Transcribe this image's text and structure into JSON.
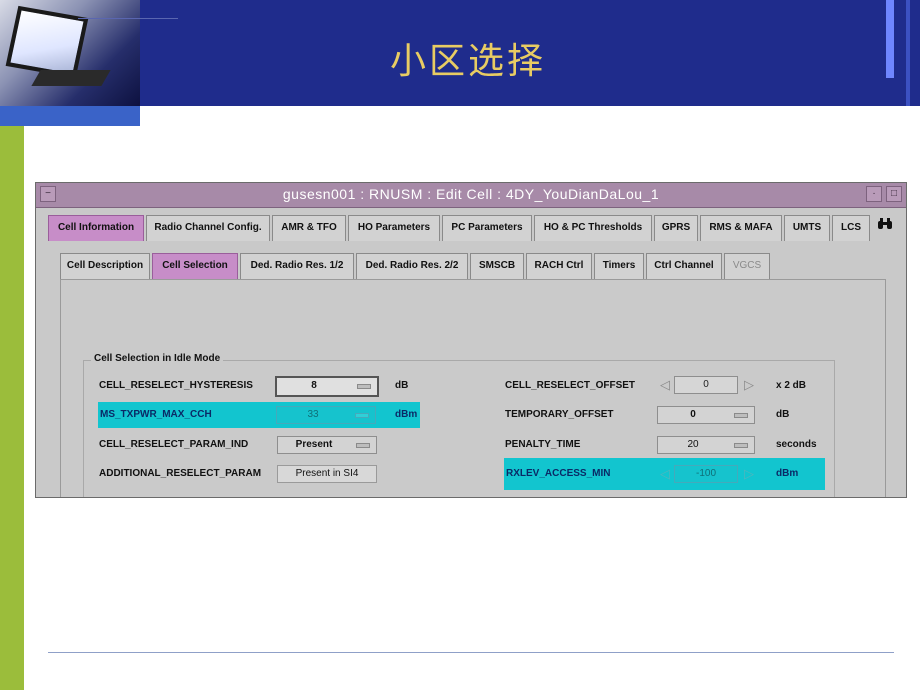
{
  "slide": {
    "title": "小区选择"
  },
  "window": {
    "title": "gusesn001 : RNUSM : Edit Cell : 4DY_YouDianDaLou_1",
    "menu_btn": "−",
    "min_btn": "·",
    "max_btn": "□"
  },
  "main_tabs": [
    {
      "label": "Cell Information",
      "active": true
    },
    {
      "label": "Radio Channel Config."
    },
    {
      "label": "AMR & TFO"
    },
    {
      "label": "HO Parameters"
    },
    {
      "label": "PC Parameters"
    },
    {
      "label": "HO & PC Thresholds"
    },
    {
      "label": "GPRS"
    },
    {
      "label": "RMS & MAFA"
    },
    {
      "label": "UMTS"
    },
    {
      "label": "LCS"
    }
  ],
  "binoculars_icon": "binoculars-icon",
  "sub_tabs": [
    {
      "label": "Cell Description"
    },
    {
      "label": "Cell Selection",
      "active": true
    },
    {
      "label": "Ded. Radio Res. 1/2"
    },
    {
      "label": "Ded. Radio Res. 2/2"
    },
    {
      "label": "SMSCB"
    },
    {
      "label": "RACH Ctrl"
    },
    {
      "label": "Timers"
    },
    {
      "label": "Ctrl Channel"
    },
    {
      "label": "VGCS",
      "disabled": true
    }
  ],
  "group": {
    "title": "Cell Selection in Idle Mode",
    "left": [
      {
        "label": "CELL_RESELECT_HYSTERESIS",
        "value": "8",
        "unit": "dB"
      },
      {
        "label": "MS_TXPWR_MAX_CCH",
        "value": "33",
        "unit": "dBm",
        "highlighted": true
      },
      {
        "label": "CELL_RESELECT_PARAM_IND",
        "value": "Present",
        "unit": ""
      },
      {
        "label": "ADDITIONAL_RESELECT_PARAM",
        "value": "Present in SI4",
        "unit": ""
      }
    ],
    "right": [
      {
        "label": "CELL_RESELECT_OFFSET",
        "value": "0",
        "unit": "x 2 dB"
      },
      {
        "label": "TEMPORARY_OFFSET",
        "value": "0",
        "unit": "dB"
      },
      {
        "label": "PENALTY_TIME",
        "value": "20",
        "unit": "seconds"
      },
      {
        "label": "RXLEV_ACCESS_MIN",
        "value": "-100",
        "unit": "dBm",
        "highlighted": true
      }
    ]
  },
  "colors": {
    "slide_band": "#1f2c8c",
    "slide_title": "#e8cc63",
    "accent_green": "#9bbd3b",
    "window_title": "#a78aa8",
    "active_tab": "#c78dc8",
    "highlight": "#12c5cf"
  }
}
